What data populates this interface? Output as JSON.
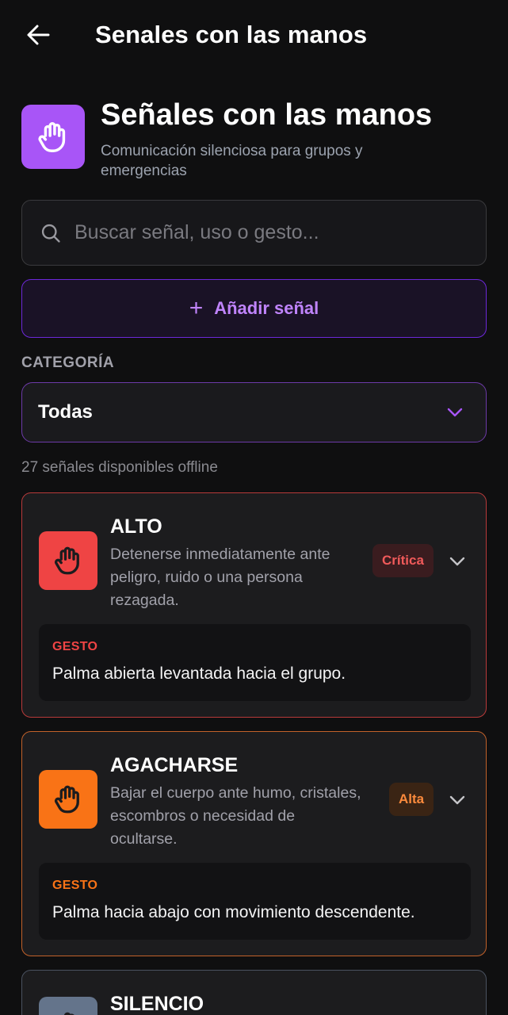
{
  "topbar": {
    "title": "Senales con las manos"
  },
  "hero": {
    "title": "Señales con las manos",
    "subtitle": "Comunicación silenciosa para grupos y emergencias"
  },
  "search": {
    "placeholder": "Buscar señal, uso o gesto..."
  },
  "add_button": {
    "label": "Añadir señal"
  },
  "category": {
    "label": "CATEGORÍA",
    "selected": "Todas"
  },
  "count_text": "27 señales disponibles offline",
  "signals": [
    {
      "title": "ALTO",
      "description": "Detenerse inmediatamente ante peligro, ruido o una persona rezagada.",
      "priority": "Crítica",
      "gesture_label": "GESTO",
      "gesture": "Palma abierta levantada hacia el grupo.",
      "color": "#ef4444"
    },
    {
      "title": "AGACHARSE",
      "description": "Bajar el cuerpo ante humo, cristales, escombros o necesidad de ocultarse.",
      "priority": "Alta",
      "gesture_label": "GESTO",
      "gesture": "Palma hacia abajo con movimiento descendente.",
      "color": "#f97316"
    },
    {
      "title": "SILENCIO",
      "color": "#64748b"
    }
  ],
  "icons": {
    "back": "arrow-left-icon",
    "hand": "hand-icon",
    "search": "search-icon",
    "plus": "plus-icon",
    "chevron": "chevron-down-icon"
  },
  "colors": {
    "accent": "#a855f7",
    "background": "#0f0f10"
  }
}
